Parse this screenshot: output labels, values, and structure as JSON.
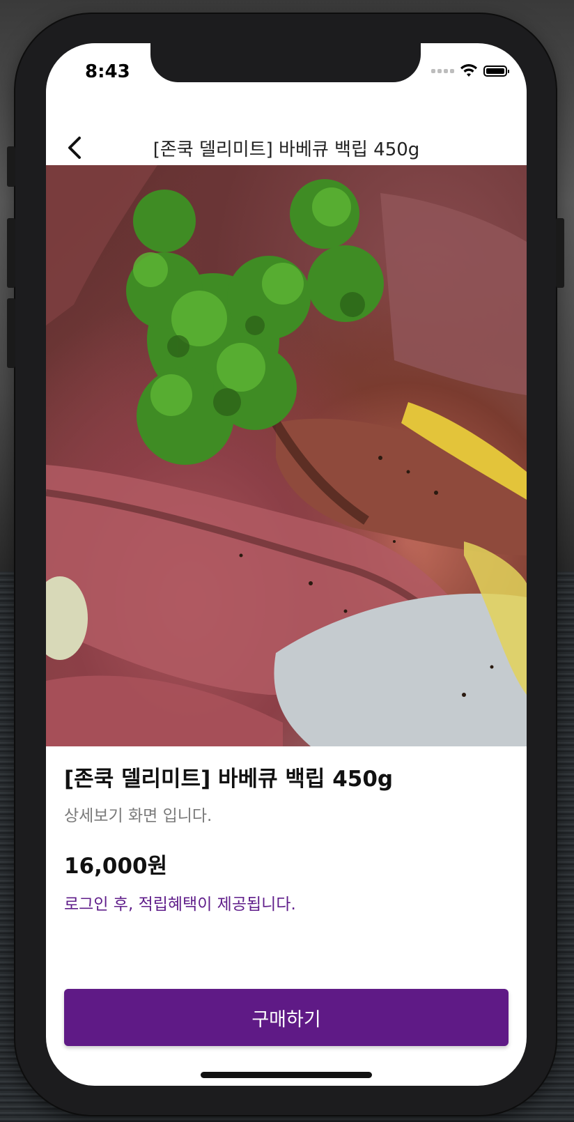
{
  "status_bar": {
    "time": "8:43",
    "icons": [
      "signal-icon",
      "wifi-icon",
      "battery-icon"
    ]
  },
  "navbar": {
    "back_icon": "chevron-left-icon",
    "title": "[존쿡 델리미트] 바베큐 백립 450g"
  },
  "product": {
    "image_description_icon": "product-photo",
    "name": "[존쿡 델리미트] 바베큐 백립 450g",
    "description": "상세보기 화면 입니다.",
    "price": "16,000원",
    "benefit_notice": "로그인 후, 적립혜택이 제공됩니다."
  },
  "actions": {
    "buy_label": "구매하기"
  },
  "colors": {
    "accent": "#5f1a86",
    "benefit_text": "#5f1d8a",
    "description_text": "#7a7a7a"
  }
}
